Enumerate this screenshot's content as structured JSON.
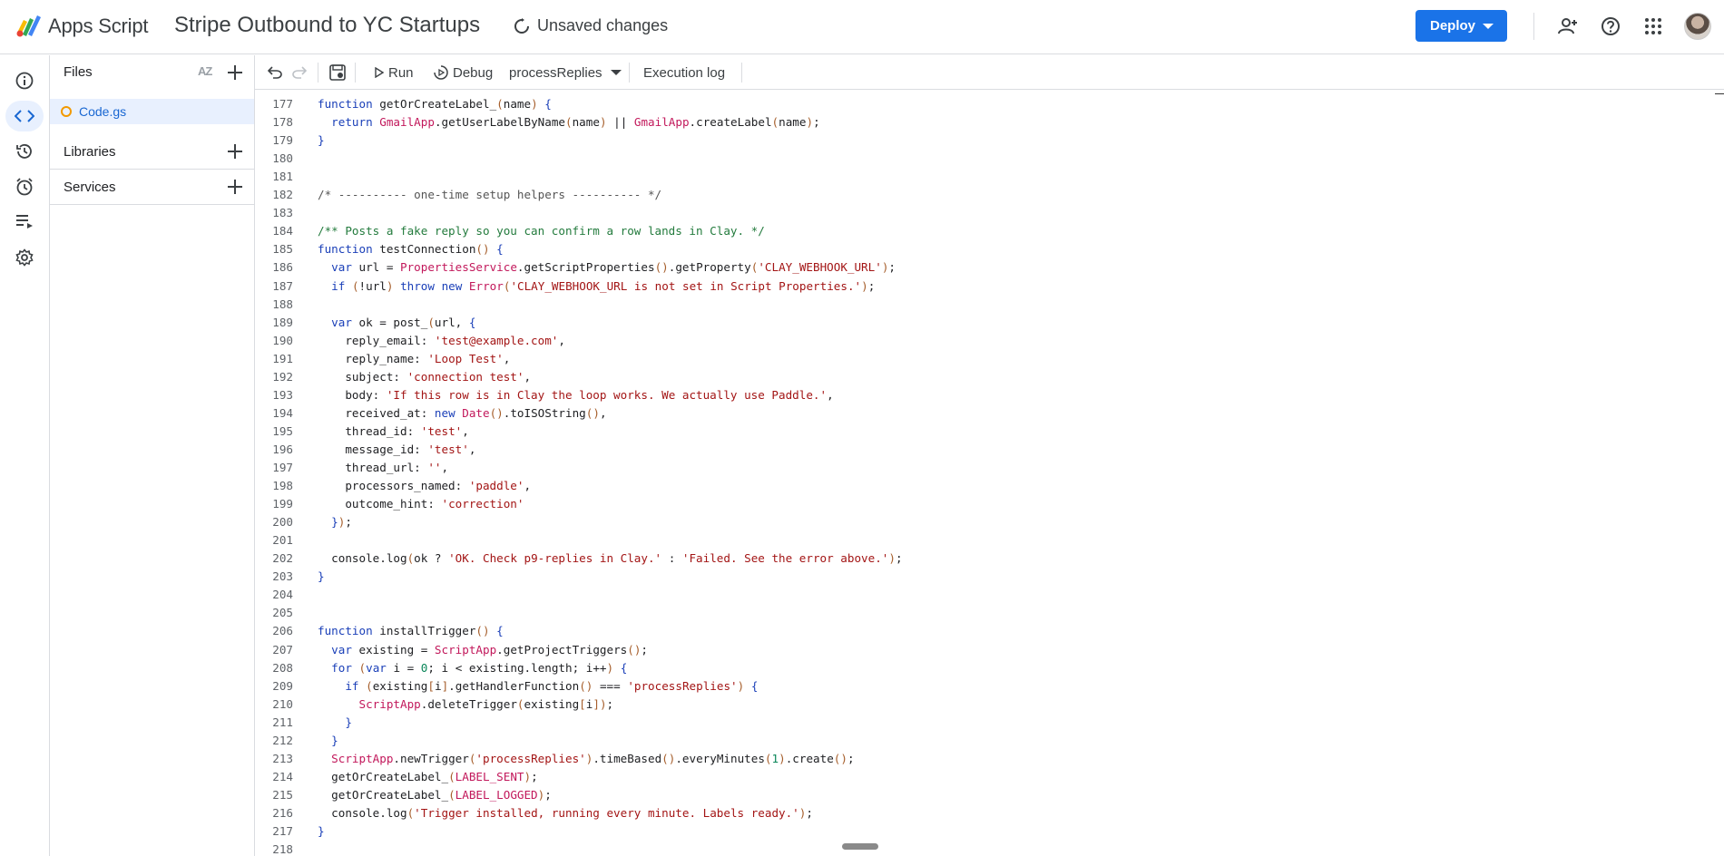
{
  "header": {
    "app_name": "Apps Script",
    "project_title": "Stripe Outbound to YC Startups",
    "status": "Unsaved changes",
    "deploy_label": "Deploy",
    "icons": [
      "add-person-icon",
      "help-icon",
      "apps-grid-icon"
    ]
  },
  "rail": {
    "items": [
      "overview-icon",
      "editor-icon",
      "history-icon",
      "triggers-icon",
      "executions-icon",
      "settings-icon"
    ],
    "active": "editor-icon"
  },
  "files_panel": {
    "title": "Files",
    "sort_label": "AZ",
    "files": [
      {
        "name": "Code.gs"
      }
    ],
    "sections": [
      {
        "label": "Libraries"
      },
      {
        "label": "Services"
      }
    ]
  },
  "toolbar": {
    "run_label": "Run",
    "debug_label": "Debug",
    "function_select": "processReplies",
    "execution_log_label": "Execution log"
  },
  "editor": {
    "lines": [
      {
        "n": "177",
        "html": "<span class=\"k\">function</span> getOrCreateLabel_<span class=\"p\">(</span>name<span class=\"p\">)</span> <span class=\"k\">{</span>"
      },
      {
        "n": "178",
        "html": "  <span class=\"k\">return</span> <span class=\"cl\">GmailApp</span>.getUserLabelByName<span class=\"p\">(</span>name<span class=\"p\">)</span> || <span class=\"cl\">GmailApp</span>.createLabel<span class=\"p\">(</span>name<span class=\"p\">)</span>;"
      },
      {
        "n": "179",
        "html": "<span class=\"k\">}</span>"
      },
      {
        "n": "180",
        "html": ""
      },
      {
        "n": "181",
        "html": ""
      },
      {
        "n": "182",
        "html": "<span class=\"c\">/* ---------- one-time setup helpers ---------- */</span>"
      },
      {
        "n": "183",
        "html": ""
      },
      {
        "n": "184",
        "html": "<span class=\"cd\">/** Posts a fake reply so you can confirm a row lands in Clay. */</span>"
      },
      {
        "n": "185",
        "html": "<span class=\"k\">function</span> testConnection<span class=\"p\">()</span> <span class=\"k\">{</span>"
      },
      {
        "n": "186",
        "html": "  <span class=\"k\">var</span> url = <span class=\"cl\">PropertiesService</span>.getScriptProperties<span class=\"p\">()</span>.getProperty<span class=\"p\">(</span><span class=\"s\">'CLAY_WEBHOOK_URL'</span><span class=\"p\">)</span>;"
      },
      {
        "n": "187",
        "html": "  <span class=\"k\">if</span> <span class=\"p\">(</span>!url<span class=\"p\">)</span> <span class=\"k\">throw</span> <span class=\"k\">new</span> <span class=\"cl\">Error</span><span class=\"p\">(</span><span class=\"s\">'CLAY_WEBHOOK_URL is not set in Script Properties.'</span><span class=\"p\">)</span>;"
      },
      {
        "n": "188",
        "html": ""
      },
      {
        "n": "189",
        "html": "  <span class=\"k\">var</span> ok = post_<span class=\"p\">(</span>url, <span class=\"k\">{</span>"
      },
      {
        "n": "190",
        "html": "    reply_email: <span class=\"s\">'test@example.com'</span>,"
      },
      {
        "n": "191",
        "html": "    reply_name: <span class=\"s\">'Loop Test'</span>,"
      },
      {
        "n": "192",
        "html": "    subject: <span class=\"s\">'connection test'</span>,"
      },
      {
        "n": "193",
        "html": "    body: <span class=\"s\">'If this row is in Clay the loop works. We actually use Paddle.'</span>,"
      },
      {
        "n": "194",
        "html": "    received_at: <span class=\"k\">new</span> <span class=\"cl\">Date</span><span class=\"p\">()</span>.toISOString<span class=\"p\">()</span>,"
      },
      {
        "n": "195",
        "html": "    thread_id: <span class=\"s\">'test'</span>,"
      },
      {
        "n": "196",
        "html": "    message_id: <span class=\"s\">'test'</span>,"
      },
      {
        "n": "197",
        "html": "    thread_url: <span class=\"s\">''</span>,"
      },
      {
        "n": "198",
        "html": "    processors_named: <span class=\"s\">'paddle'</span>,"
      },
      {
        "n": "199",
        "html": "    outcome_hint: <span class=\"s\">'correction'</span>"
      },
      {
        "n": "200",
        "html": "  <span class=\"k\">}</span><span class=\"p\">)</span>;"
      },
      {
        "n": "201",
        "html": ""
      },
      {
        "n": "202",
        "html": "  console.log<span class=\"p\">(</span>ok ? <span class=\"s\">'OK. Check p9-replies in Clay.'</span> : <span class=\"s\">'Failed. See the error above.'</span><span class=\"p\">)</span>;"
      },
      {
        "n": "203",
        "html": "<span class=\"k\">}</span>"
      },
      {
        "n": "204",
        "html": ""
      },
      {
        "n": "205",
        "html": ""
      },
      {
        "n": "206",
        "html": "<span class=\"k\">function</span> installTrigger<span class=\"p\">()</span> <span class=\"k\">{</span>"
      },
      {
        "n": "207",
        "html": "  <span class=\"k\">var</span> existing = <span class=\"cl\">ScriptApp</span>.getProjectTriggers<span class=\"p\">()</span>;"
      },
      {
        "n": "208",
        "html": "  <span class=\"k\">for</span> <span class=\"p\">(</span><span class=\"k\">var</span> i = <span class=\"n\">0</span>; i &lt; existing.length; i++<span class=\"p\">)</span> <span class=\"k\">{</span>"
      },
      {
        "n": "209",
        "html": "    <span class=\"k\">if</span> <span class=\"p\">(</span>existing<span class=\"p\">[</span>i<span class=\"p\">]</span>.getHandlerFunction<span class=\"p\">()</span> === <span class=\"s\">'processReplies'</span><span class=\"p\">)</span> <span class=\"k\">{</span>"
      },
      {
        "n": "210",
        "html": "      <span class=\"cl\">ScriptApp</span>.deleteTrigger<span class=\"p\">(</span>existing<span class=\"p\">[</span>i<span class=\"p\">]</span><span class=\"p\">)</span>;"
      },
      {
        "n": "211",
        "html": "    <span class=\"k\">}</span>"
      },
      {
        "n": "212",
        "html": "  <span class=\"k\">}</span>"
      },
      {
        "n": "213",
        "html": "  <span class=\"cl\">ScriptApp</span>.newTrigger<span class=\"p\">(</span><span class=\"s\">'processReplies'</span><span class=\"p\">)</span>.timeBased<span class=\"p\">()</span>.everyMinutes<span class=\"p\">(</span><span class=\"n\">1</span><span class=\"p\">)</span>.create<span class=\"p\">()</span>;"
      },
      {
        "n": "214",
        "html": "  getOrCreateLabel_<span class=\"p\">(</span><span class=\"cl\">LABEL_SENT</span><span class=\"p\">)</span>;"
      },
      {
        "n": "215",
        "html": "  getOrCreateLabel_<span class=\"p\">(</span><span class=\"cl\">LABEL_LOGGED</span><span class=\"p\">)</span>;"
      },
      {
        "n": "216",
        "html": "  console.log<span class=\"p\">(</span><span class=\"s\">'Trigger installed, running every minute. Labels ready.'</span><span class=\"p\">)</span>;"
      },
      {
        "n": "217",
        "html": "<span class=\"k\">}</span>"
      },
      {
        "n": "218",
        "html": ""
      }
    ]
  },
  "colors": {
    "accent": "#1a73e8",
    "keyword": "#1a3fb8",
    "string": "#a31515",
    "class": "#c2185b",
    "doc_comment": "#237b3d"
  }
}
